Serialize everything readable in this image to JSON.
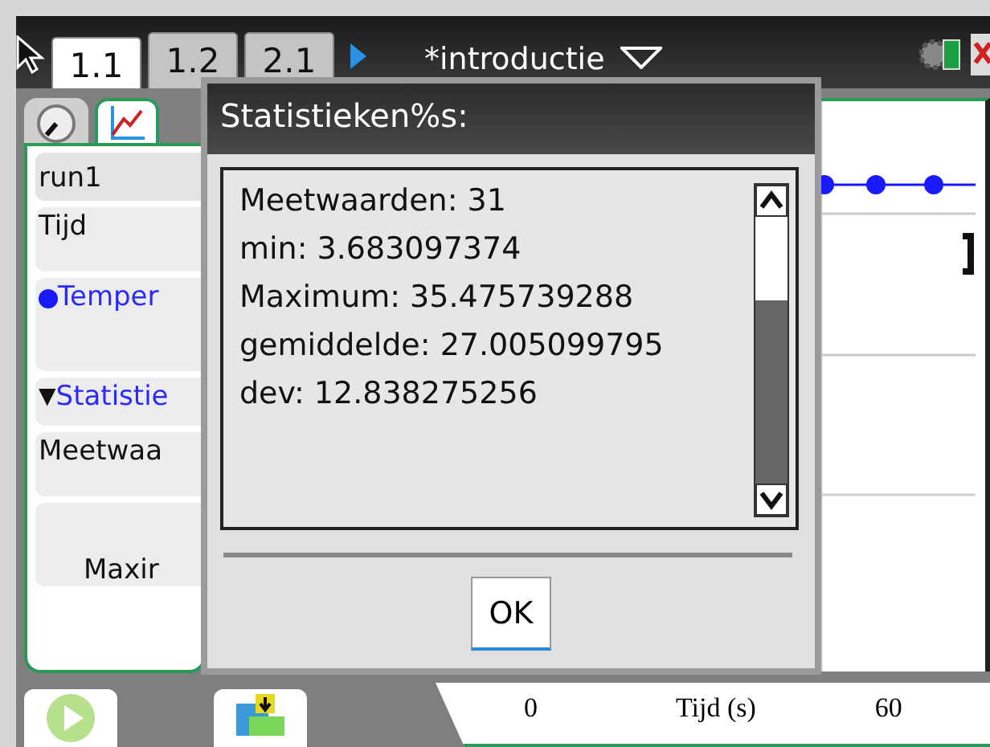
{
  "top_bar": {
    "tabs": [
      {
        "label": "1.1",
        "selected": true
      },
      {
        "label": "1.2",
        "selected": false
      },
      {
        "label": "2.1",
        "selected": false
      }
    ],
    "document_title": "*introductie"
  },
  "left_panel": {
    "view_tabs": [
      {
        "kind": "gauge",
        "selected": false
      },
      {
        "kind": "graph",
        "selected": true
      }
    ],
    "rows": [
      {
        "kind": "run",
        "text": "run1"
      },
      {
        "kind": "plain",
        "text": "Tijd"
      },
      {
        "kind": "series",
        "text": "Temper"
      },
      {
        "kind": "section",
        "text": "Statistie",
        "marker": "▼",
        "expanded": true
      },
      {
        "kind": "plain",
        "text": "Meetwaa"
      },
      {
        "kind": "cut",
        "text": "Maxir"
      }
    ]
  },
  "graph": {
    "x_tick_start": "0",
    "x_label": "Tijd (s)",
    "x_tick_end": "60"
  },
  "dialog": {
    "title": "Statistieken%s:",
    "lines": [
      "Meetwaarden: 31",
      "min: 3.683097374",
      "Maximum: 35.475739288",
      "gemiddelde: 27.005099795",
      "dev: 12.838275256"
    ],
    "button": "OK"
  }
}
